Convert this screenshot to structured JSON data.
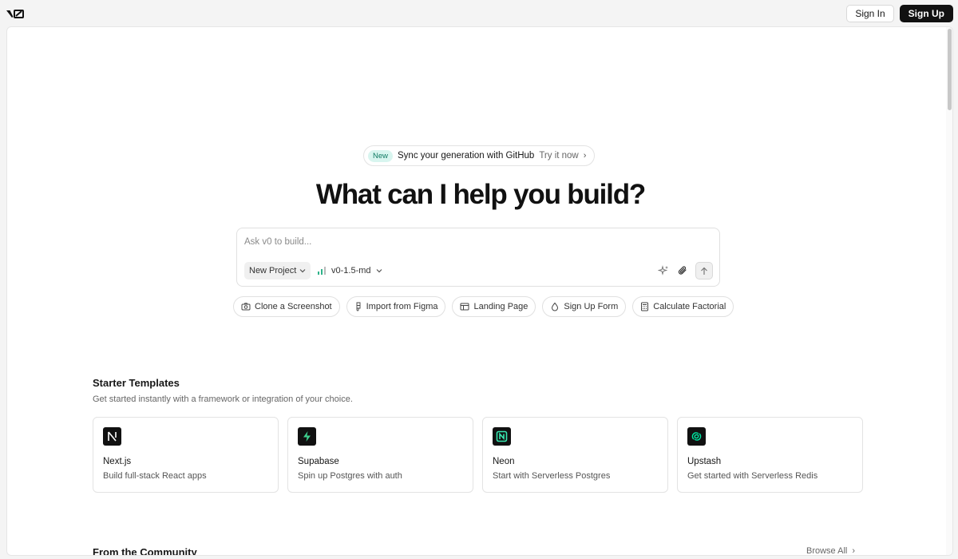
{
  "header": {
    "logo_text": "v0",
    "sign_in_label": "Sign In",
    "sign_up_label": "Sign Up"
  },
  "announcement": {
    "badge": "New",
    "text": "Sync your generation with GitHub",
    "cta": "Try it now"
  },
  "hero": {
    "title": "What can I help you build?"
  },
  "prompt": {
    "placeholder": "Ask v0 to build...",
    "value": "",
    "project_select": "New Project",
    "model_select": "v0-1.5-md"
  },
  "chips": [
    {
      "label": "Clone a Screenshot",
      "icon": "camera-icon"
    },
    {
      "label": "Import from Figma",
      "icon": "figma-icon"
    },
    {
      "label": "Landing Page",
      "icon": "layout-icon"
    },
    {
      "label": "Sign Up Form",
      "icon": "droplet-icon"
    },
    {
      "label": "Calculate Factorial",
      "icon": "calculator-icon"
    }
  ],
  "starter_templates": {
    "title": "Starter Templates",
    "subtitle": "Get started instantly with a framework or integration of your choice.",
    "cards": [
      {
        "name": "Next.js",
        "description": "Build full-stack React apps",
        "icon": "nextjs-icon",
        "accent": "#111111"
      },
      {
        "name": "Supabase",
        "description": "Spin up Postgres with auth",
        "icon": "supabase-icon",
        "accent": "#3ecf8e"
      },
      {
        "name": "Neon",
        "description": "Start with Serverless Postgres",
        "icon": "neon-icon",
        "accent": "#37e8b0"
      },
      {
        "name": "Upstash",
        "description": "Get started with Serverless Redis",
        "icon": "upstash-icon",
        "accent": "#00e9a3"
      }
    ]
  },
  "community": {
    "title": "From the Community",
    "browse_all": "Browse All"
  },
  "colors": {
    "accent_dark": "#111111",
    "new_badge_bg": "#d8f5ef",
    "new_badge_text": "#0f7a63"
  }
}
